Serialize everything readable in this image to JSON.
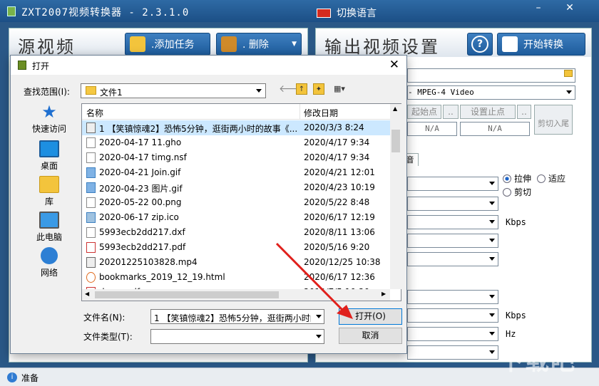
{
  "app": {
    "title": "ZXT2007视频转换器 - 2.3.1.0",
    "language_label": "切换语言",
    "status": "准备"
  },
  "source_pane": {
    "title": "源视频",
    "add_task": ".添加任务",
    "delete": ". 删除"
  },
  "output_pane": {
    "title": "输出视频设置",
    "help": "?",
    "start": "开始转换",
    "codec": "- MPEG-4 Video",
    "set_start": "起始点",
    "set_end": "设置止点",
    "cut_tail": "剪切入尾",
    "na1": "N/A",
    "na2": "N/A",
    "radio_stretch": "拉伸",
    "radio_fit": "适应",
    "radio_crop": "剪切",
    "kbps_video": "Kbps",
    "kbps_audio": "Kbps",
    "hz": "Hz",
    "tab": "音"
  },
  "dialog": {
    "title": "打开",
    "look_in_label": "查找范围(I):",
    "look_in_value": "文件1",
    "col_name": "名称",
    "col_date": "修改日期",
    "places": [
      "快速访问",
      "桌面",
      "库",
      "此电脑",
      "网络"
    ],
    "files": [
      {
        "name": "1 【笑镇惊魂2】恐怖5分钟，逛街两小时的故事《...",
        "date": "2020/3/3 8:24",
        "icon": "video-file-icon",
        "selected": true
      },
      {
        "name": "2020-04-17 11.gho",
        "date": "2020/4/17 9:34",
        "icon": "file-icon"
      },
      {
        "name": "2020-04-17 timg.nsf",
        "date": "2020/4/17 9:34",
        "icon": "file-icon"
      },
      {
        "name": "2020-04-21 Join.gif",
        "date": "2020/4/21 12:01",
        "icon": "gif-icon"
      },
      {
        "name": "2020-04-23 图片.gif",
        "date": "2020/4/23 10:19",
        "icon": "gif-icon"
      },
      {
        "name": "2020-05-22 00.png",
        "date": "2020/5/22 8:48",
        "icon": "file-icon"
      },
      {
        "name": "2020-06-17 zip.ico",
        "date": "2020/6/17 12:19",
        "icon": "image-icon"
      },
      {
        "name": "5993ecb2dd217.dxf",
        "date": "2020/8/11 13:06",
        "icon": "file-icon"
      },
      {
        "name": "5993ecb2dd217.pdf",
        "date": "2020/5/16 9:20",
        "icon": "pdf-icon"
      },
      {
        "name": "20201225103828.mp4",
        "date": "2020/12/25 10:38",
        "icon": "video-file-icon"
      },
      {
        "name": "bookmarks_2019_12_19.html",
        "date": "2020/6/17 12:36",
        "icon": "html-icon"
      },
      {
        "name": "demo.pdf",
        "date": "2019/7/5 10:20",
        "icon": "pdf-icon"
      }
    ],
    "filename_label": "文件名(N):",
    "filename_value": "1 【笑镇惊魂2】恐怖5分钟，逛街两小时的",
    "filetype_label": "文件类型(T):",
    "filetype_value": "",
    "open_button": "打开(O)",
    "cancel_button": "取消"
  },
  "watermark": "下载吧",
  "colors": {
    "arrow": "#e0201c",
    "accent": "#1e5c9c"
  }
}
